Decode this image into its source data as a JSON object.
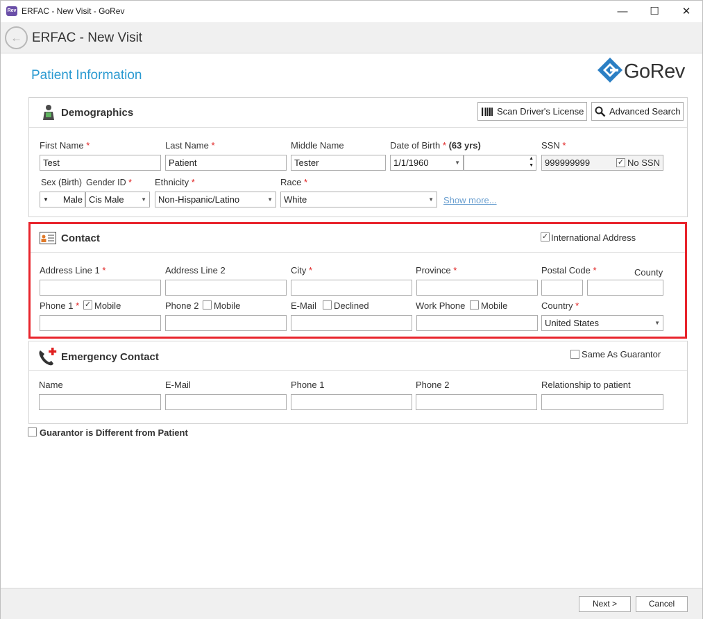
{
  "window": {
    "app_icon_text": "Rev",
    "title": "ERFAC - New Visit - GoRev",
    "minimize": "—",
    "maximize": "☐",
    "close": "✕"
  },
  "nav": {
    "title": "ERFAC - New Visit"
  },
  "page": {
    "section_title": "Patient Information",
    "logo_text": "GoRev"
  },
  "demographics": {
    "title": "Demographics",
    "scan_button": "Scan Driver's License",
    "search_button": "Advanced Search",
    "first_name_label": "First Name",
    "first_name": "Test",
    "last_name_label": "Last Name",
    "last_name": "Patient",
    "middle_name_label": "Middle Name",
    "middle_name": "Tester",
    "dob_label": "Date of Birth",
    "dob_age": "(63 yrs)",
    "dob": "1/1/1960",
    "ssn_label": "SSN",
    "ssn": "999999999",
    "no_ssn_label": "No SSN",
    "no_ssn_checked": true,
    "sex_label": "Sex (Birth)",
    "sex": "Male",
    "gender_label": "Gender ID",
    "gender": "Cis Male",
    "ethnicity_label": "Ethnicity",
    "ethnicity": "Non-Hispanic/Latino",
    "race_label": "Race",
    "race": "White",
    "show_more": "Show more..."
  },
  "contact": {
    "title": "Contact",
    "intl_label": "International Address",
    "intl_checked": true,
    "addr1_label": "Address Line 1",
    "addr2_label": "Address Line 2",
    "city_label": "City",
    "province_label": "Province",
    "postal_label": "Postal Code",
    "county_label": "County",
    "phone1_label": "Phone 1",
    "phone1_mobile_label": "Mobile",
    "phone1_mobile_checked": true,
    "phone2_label": "Phone 2",
    "phone2_mobile_label": "Mobile",
    "email_label": "E-Mail",
    "email_declined_label": "Declined",
    "work_phone_label": "Work Phone",
    "work_mobile_label": "Mobile",
    "country_label": "Country",
    "country": "United States"
  },
  "emergency": {
    "title": "Emergency Contact",
    "same_as_label": "Same As Guarantor",
    "name_label": "Name",
    "email_label": "E-Mail",
    "phone1_label": "Phone 1",
    "phone2_label": "Phone 2",
    "relationship_label": "Relationship to patient"
  },
  "guarantor": {
    "label": "Guarantor is Different from Patient"
  },
  "footer": {
    "next": "Next >",
    "cancel": "Cancel"
  },
  "colors": {
    "accent": "#2b9ad1",
    "required": "#e02020",
    "highlight": "#e8242c"
  }
}
